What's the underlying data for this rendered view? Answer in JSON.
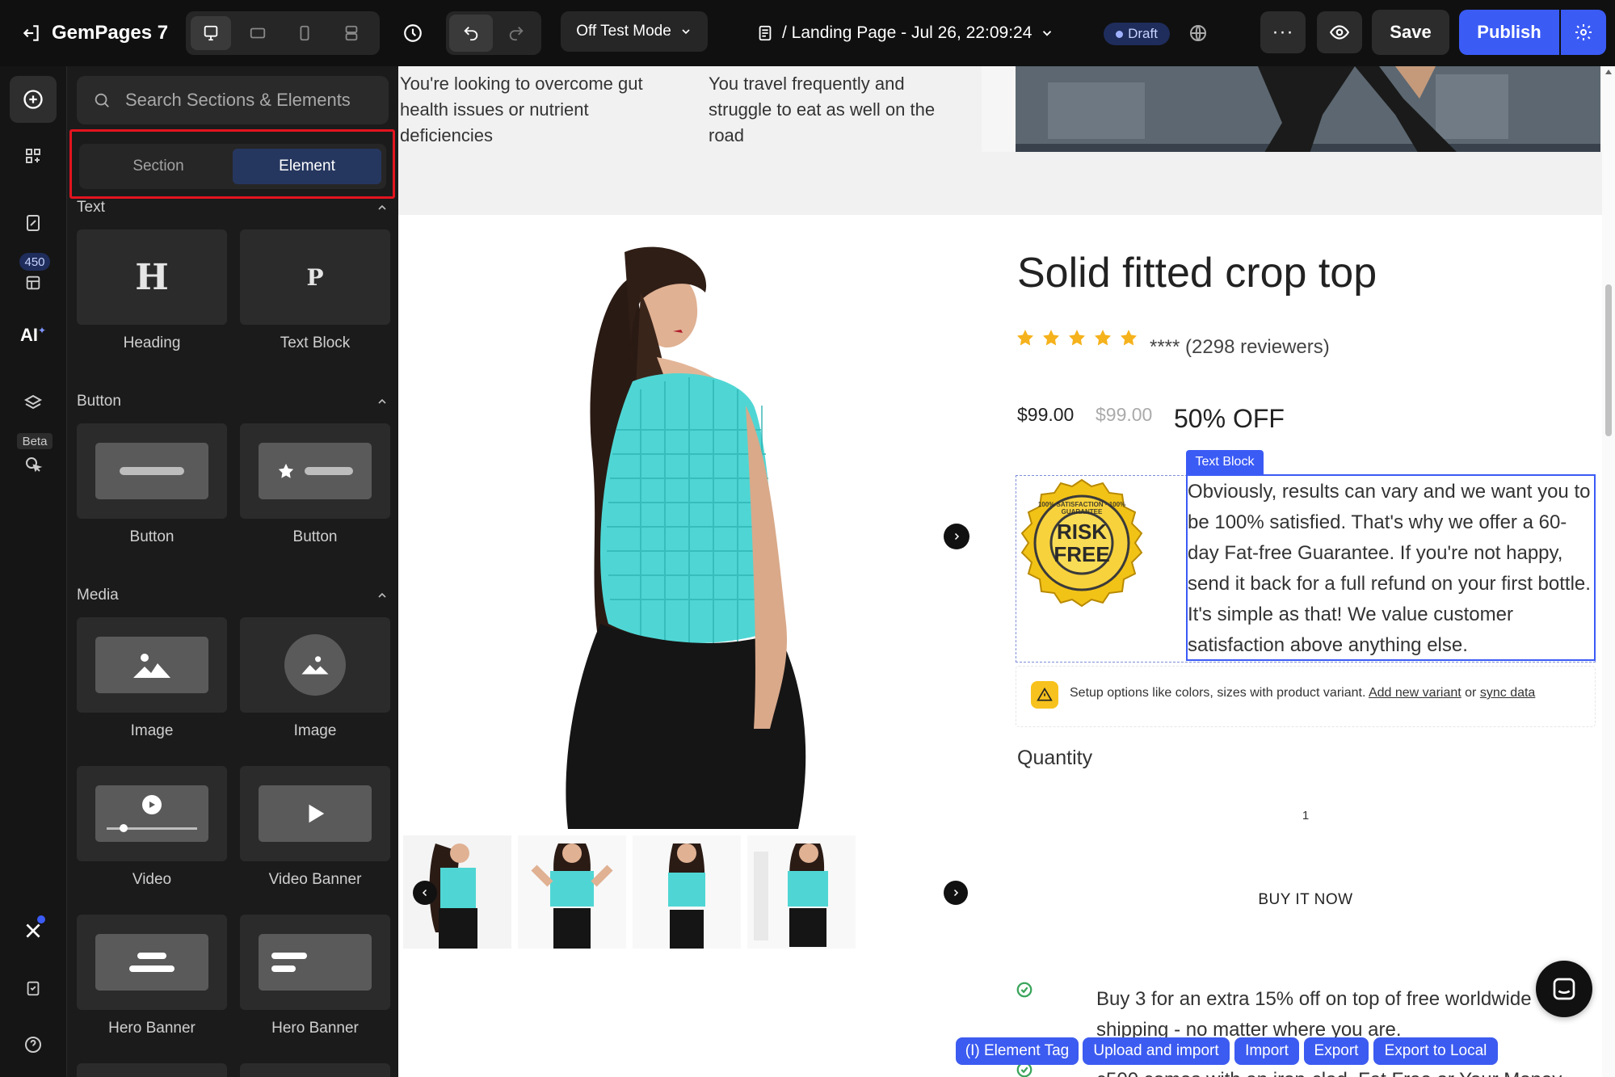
{
  "topbar": {
    "logo_text": "GemPages 7",
    "test_mode": "Off Test Mode",
    "page_path": "/ Landing Page - Jul 26, 22:09:24",
    "status": "Draft",
    "save": "Save",
    "publish": "Publish",
    "accent": "#3b5bf5"
  },
  "rail": {
    "count": "450",
    "ai": "AI",
    "beta": "Beta"
  },
  "panel": {
    "search_placeholder": "Search Sections & Elements",
    "tabs": [
      "Section",
      "Element"
    ],
    "active_tab": "Element",
    "categories": {
      "text": "Text",
      "button": "Button",
      "media": "Media"
    },
    "items": {
      "heading": "Heading",
      "text_block": "Text Block",
      "button_1": "Button",
      "button_2": "Button",
      "image_1": "Image",
      "image_2": "Image",
      "video": "Video",
      "video_banner": "Video Banner",
      "hero_1": "Hero Banner",
      "hero_2": "Hero Banner"
    }
  },
  "canvas": {
    "problem_1": "You're looking to overcome gut health issues or nutrient deficiencies",
    "problem_2": "You travel frequently and struggle to eat as well on the road",
    "product_title": "Solid fitted crop top",
    "rating_text": "**** (2298 reviewers)",
    "rating": 5,
    "price": "$99.00",
    "compare_price": "$99.00",
    "discount": "50% OFF",
    "text_block_tag": "Text Block",
    "guarantee_text": "Obviously, results can vary and we want you to be 100% satisfied. That's why we offer a 60-day Fat-free Guarantee. If you're not happy, send it back for a full refund on your first bottle. It's simple as that! We value customer satisfaction above anything else.",
    "seal_lines": [
      "RISK",
      "FREE"
    ],
    "seal_ring": "100% SATISFACTION · 100% GUARANTEE",
    "variant_notice": "Setup options like colors, sizes with product variant.",
    "variant_link_1": "Add new variant",
    "variant_or": "or",
    "variant_link_2": "sync data",
    "quantity_label": "Quantity",
    "quantity_value": "1",
    "buy_now": "BUY IT NOW",
    "benefit_1": "Buy 3 for an extra 15% off on top of free worldwide shipping - no matter where you are.",
    "benefit_2": "c500 comes with an iron-clad, Fat Free or Your Money"
  },
  "bottom_actions": [
    "(I) Element Tag",
    "Upload and import",
    "Import",
    "Export",
    "Export to Local"
  ]
}
